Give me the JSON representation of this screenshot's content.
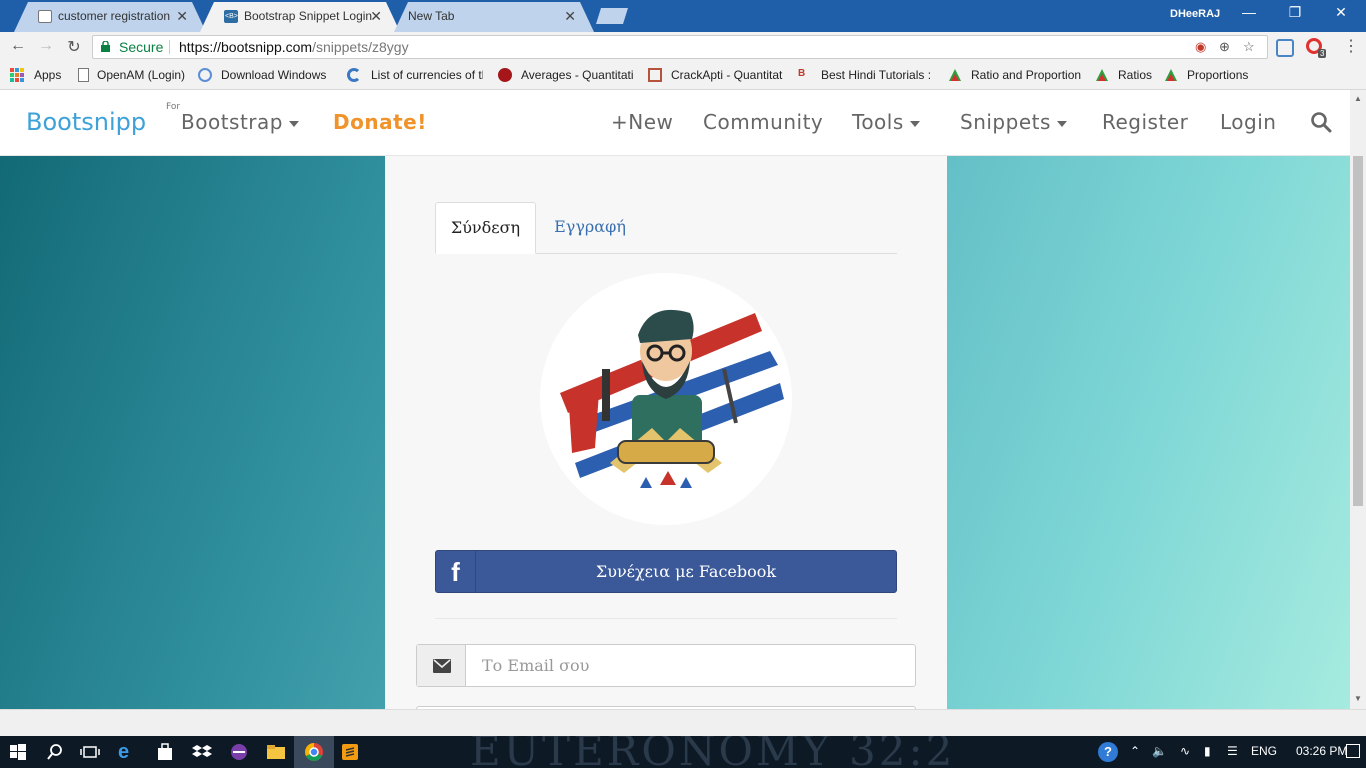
{
  "browser": {
    "tabs": [
      {
        "title": "customer registration",
        "close": "✕"
      },
      {
        "title": "Bootstrap Snippet Login",
        "close": "✕"
      },
      {
        "title": "New Tab",
        "close": "✕"
      }
    ],
    "user": "DHeeRAJ",
    "window_controls": {
      "minimize": "—",
      "restore": "❐",
      "close": "✕"
    },
    "secure_label": "Secure",
    "url_host": "https://bootsnipp.com",
    "url_path": "/snippets/z8ygy",
    "bookmarks": [
      {
        "label": "Apps",
        "icon": "apps-grid-icon"
      },
      {
        "label": "OpenAM (Login)",
        "icon": "page-icon"
      },
      {
        "label": "Download Windows",
        "icon": "globe-icon"
      },
      {
        "label": "List of currencies of th",
        "icon": "currency-icon"
      },
      {
        "label": "Averages - Quantitati",
        "icon": "averages-icon"
      },
      {
        "label": "CrackApti - Quantitat",
        "icon": "crackapti-icon"
      },
      {
        "label": "Best Hindi Tutorials :",
        "icon": "hindi-tutorials-icon"
      },
      {
        "label": "Ratio and Proportion",
        "icon": "triangle-icon"
      },
      {
        "label": "Ratios",
        "icon": "triangle-icon"
      },
      {
        "label": "Proportions",
        "icon": "triangle-icon"
      }
    ],
    "extension_badge": "3"
  },
  "site": {
    "brand": "Bootsnipp",
    "for_label": "For",
    "nav": {
      "bootstrap": "Bootstrap",
      "donate": "Donate!",
      "new": "+New",
      "community": "Community",
      "tools": "Tools",
      "snippets": "Snippets",
      "register": "Register",
      "login": "Login"
    }
  },
  "panel": {
    "tab_login": "Σύνδεση",
    "tab_register": "Εγγραφή",
    "facebook_icon": "f",
    "facebook_label": "Συνέχεια με Facebook",
    "email_placeholder": "Το Email σου"
  },
  "taskbar": {
    "wallpaper_text": "EUTERONOMY 32:2",
    "language": "ENG",
    "time": "03:26 PM"
  },
  "colors": {
    "brand": "#3ea2d8",
    "donate": "#f0932b",
    "facebook": "#3b5998",
    "secure": "#0b8043"
  }
}
